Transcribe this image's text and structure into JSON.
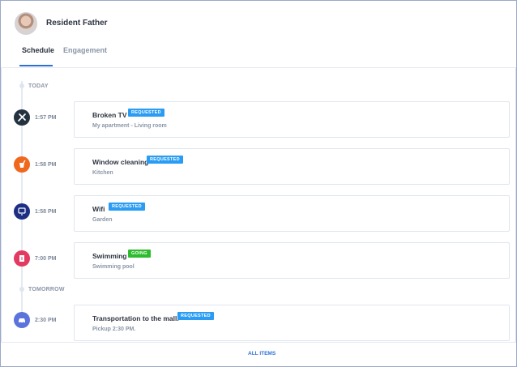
{
  "header": {
    "user_name": "Resident Father",
    "tabs": [
      {
        "label": "Schedule"
      },
      {
        "label": "Engagement"
      }
    ]
  },
  "timeline": {
    "days": [
      {
        "label": "TODAY"
      },
      {
        "label": "TOMORROW"
      }
    ],
    "items": [
      {
        "time": "1:57 PM",
        "title": "Broken TV",
        "status": "REQUESTED",
        "subtitle": "My apartment - Living room",
        "icon": "wrench-screwdriver-icon",
        "icon_color": "#24313f",
        "status_color": "#2a9cf3"
      },
      {
        "time": "1:58 PM",
        "title": "Window cleaning",
        "status": "REQUESTED",
        "subtitle": "Kitchen",
        "icon": "cleaning-bucket-icon",
        "icon_color": "#f0671e",
        "status_color": "#2a9cf3"
      },
      {
        "time": "1:58 PM",
        "title": "Wifi",
        "status": "REQUESTED",
        "subtitle": "Garden",
        "icon": "monitor-icon",
        "icon_color": "#1c2f84",
        "status_color": "#2a9cf3"
      },
      {
        "time": "7:00 PM",
        "title": "Swimming",
        "status": "GOING",
        "subtitle": "Swimming pool",
        "icon": "ticket-icon",
        "icon_color": "#e33a62",
        "status_color": "#2fbb2f"
      },
      {
        "time": "2:30 PM",
        "title": "Transportation to the mall.",
        "status": "REQUESTED",
        "subtitle": "Pickup 2:30 PM.",
        "icon": "car-icon",
        "icon_color": "#5b73db",
        "status_color": "#2a9cf3"
      }
    ]
  },
  "footer": {
    "all_items_label": "ALL ITEMS"
  }
}
